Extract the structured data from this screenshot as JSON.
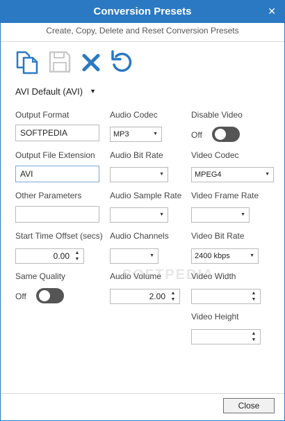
{
  "window": {
    "title": "Conversion Presets",
    "close_glyph": "✕",
    "subtitle": "Create, Copy, Delete and Reset Conversion Presets"
  },
  "toolbar": {
    "icons": [
      "copy-icon",
      "save-icon",
      "delete-icon",
      "reset-icon"
    ],
    "accent_color": "#2b79c2",
    "disabled_color": "#c9c9c9"
  },
  "preset": {
    "selected": "AVI Default (AVI)",
    "arrow": "▼"
  },
  "col1": {
    "output_format_label": "Output Format",
    "output_format_value": "SOFTPEDIA",
    "output_ext_label": "Output File Extension",
    "output_ext_value": "AVI",
    "other_params_label": "Other Parameters",
    "other_params_value": "",
    "start_offset_label": "Start Time Offset (secs)",
    "start_offset_value": "0.00",
    "same_quality_label": "Same Quality",
    "same_quality_state": "Off"
  },
  "col2": {
    "audio_codec_label": "Audio Codec",
    "audio_codec_value": "MP3",
    "audio_bitrate_label": "Audio Bit Rate",
    "audio_bitrate_value": "",
    "audio_sample_rate_label": "Audio Sample Rate",
    "audio_sample_rate_value": "",
    "audio_channels_label": "Audio Channels",
    "audio_channels_value": "",
    "audio_volume_label": "Audio Volume",
    "audio_volume_value": "2.00"
  },
  "col3": {
    "disable_video_label": "Disable Video",
    "disable_video_state": "Off",
    "video_codec_label": "Video Codec",
    "video_codec_value": "MPEG4",
    "video_frame_rate_label": "Video Frame Rate",
    "video_frame_rate_value": "",
    "video_bitrate_label": "Video Bit Rate",
    "video_bitrate_value": "2400 kbps",
    "video_width_label": "Video Width",
    "video_width_value": "",
    "video_height_label": "Video Height",
    "video_height_value": ""
  },
  "footer": {
    "close_label": "Close"
  },
  "watermark": "SOFTPEDIA"
}
